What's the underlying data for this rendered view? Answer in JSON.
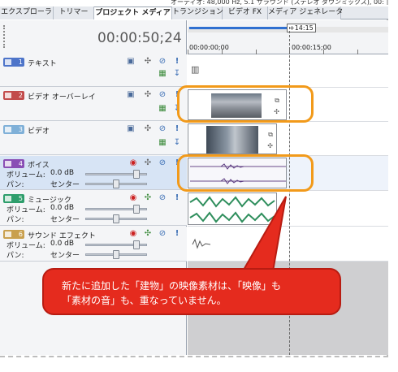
{
  "top_info": "オーディオ: 48,000 Hz, 5.1 サラウンド (ステレオ ダウンミックス), 00:",
  "tabs": [
    {
      "label": "エクスプローラ"
    },
    {
      "label": "トリマー"
    },
    {
      "label": "プロジェクト メディア"
    },
    {
      "label": "トランジション"
    },
    {
      "label": "ビデオ FX"
    },
    {
      "label": "メディア ジェネレータ"
    }
  ],
  "timecode": "00:00:50;24",
  "ruler": {
    "marker": "+14:15",
    "tc_start": "00:00:00;00",
    "tc_mid": "00:00:15;00"
  },
  "tracks": [
    {
      "number": "1",
      "name": "テキスト",
      "color": "#4d74c9"
    },
    {
      "number": "2",
      "name": "ビデオ オーバーレイ",
      "color": "#c24b4b"
    },
    {
      "number": "3",
      "name": "ビデオ",
      "color": "#7fb0d8"
    },
    {
      "number": "4",
      "name": "ボイス",
      "color": "#8a4fb5",
      "volume_label": "ボリューム:",
      "volume_value": "0.0 dB",
      "pan_label": "パン:",
      "pan_value": "センター",
      "volume_level": 0.88,
      "pan_level": 0.5
    },
    {
      "number": "5",
      "name": "ミュージック",
      "color": "#2e9e6c",
      "volume_label": "ボリューム:",
      "volume_value": "0.0 dB",
      "pan_label": "パン:",
      "pan_value": "センター",
      "volume_level": 0.88,
      "pan_level": 0.5
    },
    {
      "number": "6",
      "name": "サウンド エフェクト",
      "color": "#c9a04e",
      "volume_label": "ボリューム:",
      "volume_value": "0.0 dB",
      "pan_label": "パン:",
      "pan_value": "センター",
      "volume_level": 0.88,
      "pan_level": 0.5
    }
  ],
  "callout": {
    "line1": "新たに追加した「建物」の映像素材は、「映像」も",
    "line2": "「素材の音」も、重なっていません。"
  },
  "colors": {
    "highlight": "#f29a1a",
    "callout": "#e52b1e",
    "selected_track": "#d7e4f5"
  }
}
